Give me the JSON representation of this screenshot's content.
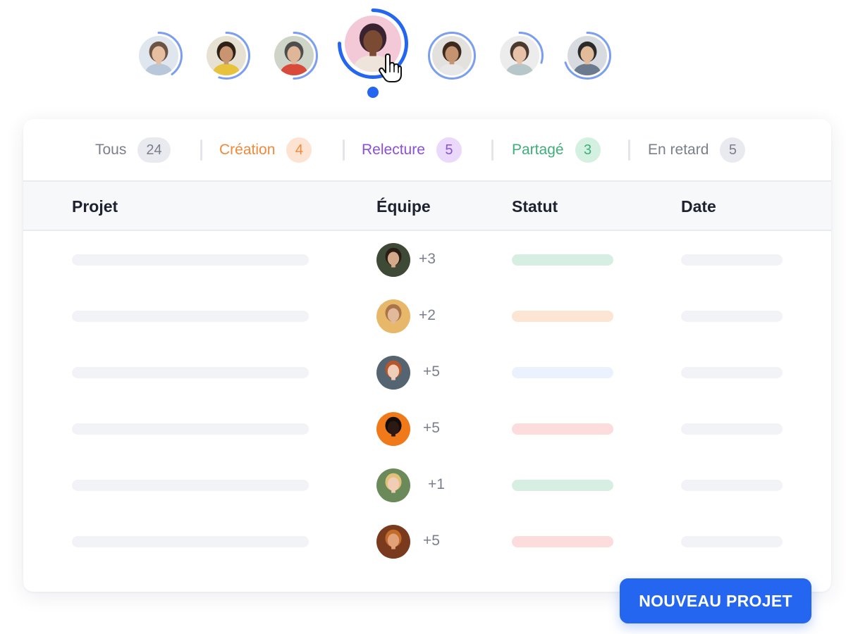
{
  "avatars": [
    {
      "name": "avatar-1",
      "progress": 0.4,
      "bg": "#dfe6ee",
      "skin": "#e6bfa1",
      "hair": "#6b5444",
      "shirt": "#b8c8da"
    },
    {
      "name": "avatar-2",
      "progress": 0.55,
      "bg": "#e6e1d3",
      "skin": "#c99570",
      "hair": "#2d2017",
      "shirt": "#e7c23d"
    },
    {
      "name": "avatar-3",
      "progress": 0.5,
      "bg": "#cfd4c9",
      "skin": "#e0b699",
      "hair": "#4d4d4d",
      "shirt": "#d84a3a"
    },
    {
      "name": "avatar-4-selected",
      "progress": 0.75,
      "bg": "#f4c9d7",
      "skin": "#7a4a33",
      "hair": "#3a2330",
      "shirt": "#efe4dc"
    },
    {
      "name": "avatar-5",
      "progress": 1.0,
      "bg": "#e3e1dd",
      "skin": "#c49370",
      "hair": "#3d2a1e",
      "shirt": "#e8e8e8"
    },
    {
      "name": "avatar-6",
      "progress": 0.3,
      "bg": "#ececec",
      "skin": "#e8c2a8",
      "hair": "#4a3a30",
      "shirt": "#b7c7c9"
    },
    {
      "name": "avatar-7",
      "progress": 0.7,
      "bg": "#d7dbe0",
      "skin": "#e2bb9b",
      "hair": "#2b2a2a",
      "shirt": "#6b7a8c"
    }
  ],
  "ring_color": "#7b9ef0",
  "ring_selected_color": "#2466f0",
  "filters": [
    {
      "label": "Tous",
      "count": "24",
      "color": "#7a7f8c",
      "badge_bg": "#e8eaef",
      "badge_fg": "#7a7f8c"
    },
    {
      "label": "Création",
      "count": "4",
      "color": "#f08a3a",
      "badge_bg": "#fde3d2",
      "badge_fg": "#f08a3a"
    },
    {
      "label": "Relecture",
      "count": "5",
      "color": "#8b4fd8",
      "badge_bg": "#ead9fb",
      "badge_fg": "#8b4fd8"
    },
    {
      "label": "Partagé",
      "count": "3",
      "color": "#3fae7b",
      "badge_bg": "#d4f0e1",
      "badge_fg": "#3fae7b"
    },
    {
      "label": "En retard",
      "count": "5",
      "color": "#7a7f8c",
      "badge_bg": "#e8eaef",
      "badge_fg": "#7a7f8c"
    }
  ],
  "table": {
    "headers": {
      "project": "Projet",
      "team": "Équipe",
      "status": "Statut",
      "date": "Date"
    },
    "rows": [
      {
        "team_extra": "+3",
        "status_color": "#d7efe2",
        "av_bg": "#3f4a36",
        "av_skin": "#d3a98a",
        "av_hair": "#2a1d15"
      },
      {
        "team_extra": "+2",
        "status_color": "#fde5d3",
        "av_bg": "#e8b86a",
        "av_skin": "#e1b99b",
        "av_hair": "#a9744a"
      },
      {
        "team_extra": "+5",
        "status_color": "#ecf2fd",
        "av_bg": "#546471",
        "av_skin": "#f0cdb8",
        "av_hair": "#b8552b"
      },
      {
        "team_extra": "+5",
        "status_color": "#fcdcdd",
        "av_bg": "#f07a1a",
        "av_skin": "#2b1a14",
        "av_hair": "#140c08"
      },
      {
        "team_extra": "+1",
        "status_color": "#d7efe2",
        "av_bg": "#6a8a5a",
        "av_skin": "#f1cdb5",
        "av_hair": "#e2c07a"
      },
      {
        "team_extra": "+5",
        "status_color": "#fcdcdd",
        "av_bg": "#7a3a1e",
        "av_skin": "#e1a27a",
        "av_hair": "#c46a2a"
      }
    ]
  },
  "cta": {
    "label": "NOUVEAU PROJET"
  }
}
